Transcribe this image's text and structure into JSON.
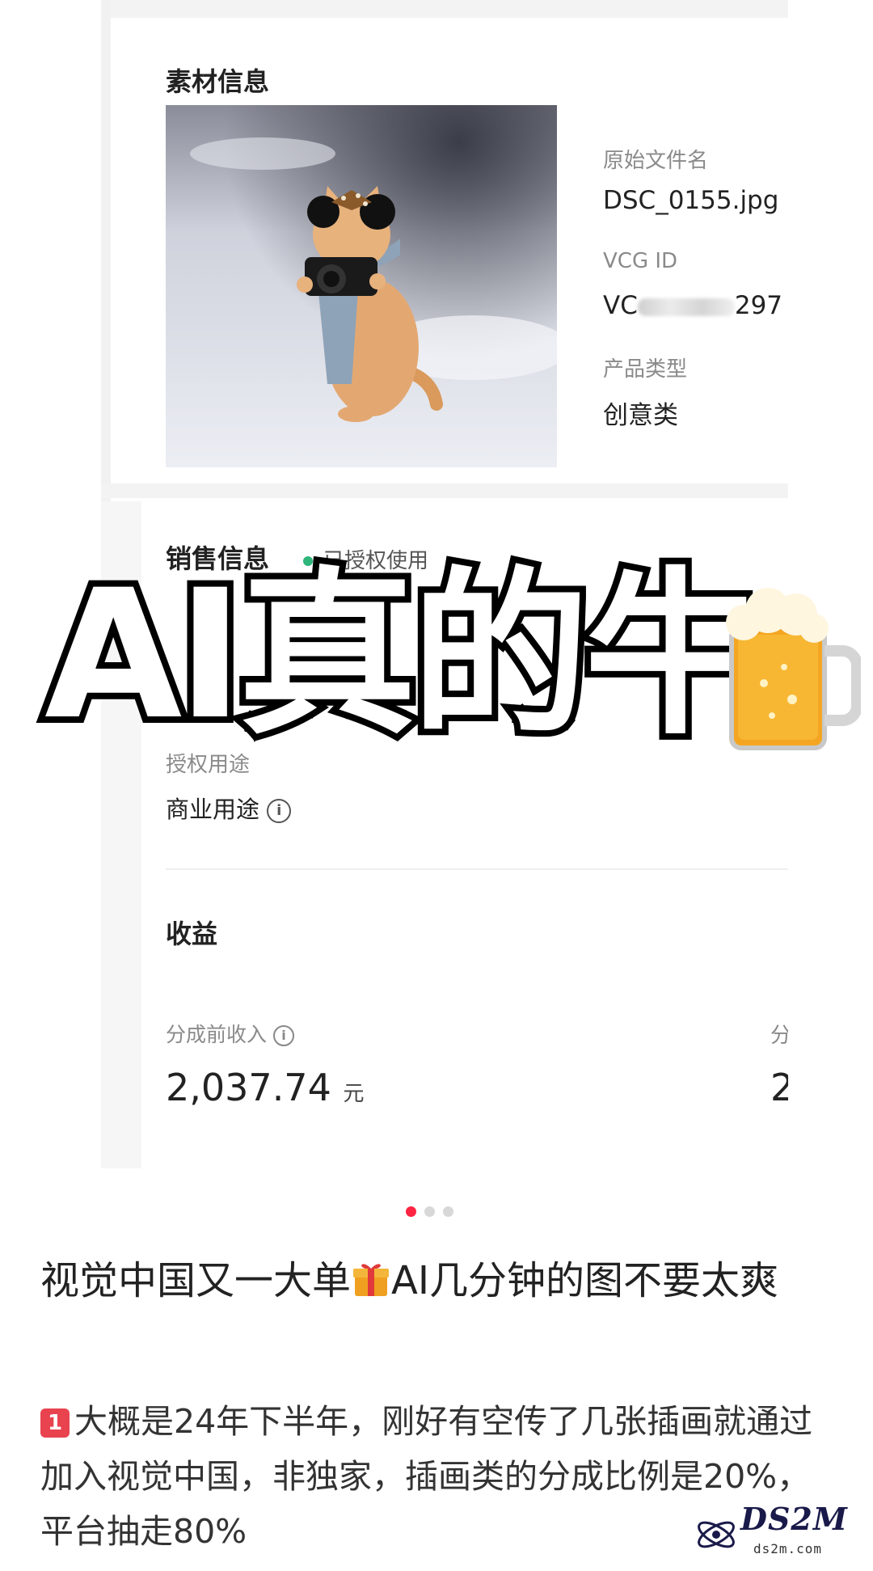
{
  "material_info": {
    "title": "素材信息",
    "original_filename_label": "原始文件名",
    "original_filename": "DSC_0155.jpg",
    "vcg_id_label": "VCG ID",
    "vcg_id_prefix": "VC",
    "vcg_id_suffix": "297",
    "product_type_label": "产品类型",
    "product_type": "创意类"
  },
  "sales_info": {
    "title": "销售信息",
    "status": "已授权使用",
    "status_color": "#2fb67b",
    "usage_label": "授权用途",
    "usage_value": "商业用途"
  },
  "earnings": {
    "title": "收益",
    "pre_split_label": "分成前收入",
    "pre_split_amount": "2,037.74",
    "currency": "元",
    "right_cut_label": "分",
    "right_cut_value": "2"
  },
  "overlay": {
    "text": "AI真的牛"
  },
  "carousel": {
    "count": 3,
    "active_index": 0
  },
  "post": {
    "title_part1": "视觉中国又一大单",
    "title_part2": "AI几分钟的图不要太爽",
    "body_badge": "1",
    "body_text": "大概是24年下半年，刚好有空传了几张插画就通过加入视觉中国，非独家，插画类的分成比例是20%，平台抽走80%"
  },
  "watermark": {
    "brand": "DS2M",
    "site": "ds2m.com"
  },
  "icons": [
    "info-icon",
    "back-chevron-icon",
    "beer-icon",
    "gift-icon",
    "keycap-one-icon"
  ]
}
